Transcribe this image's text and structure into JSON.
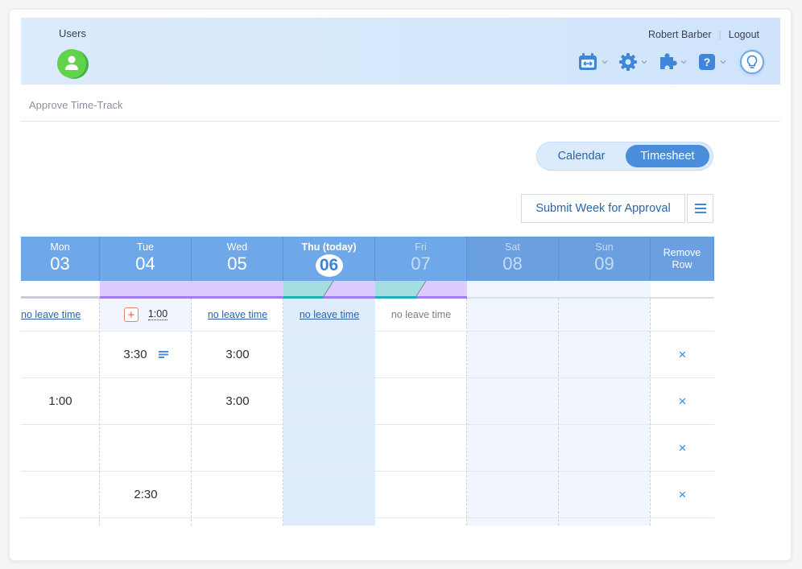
{
  "header": {
    "section_label": "Users",
    "avatar_icon": "user-avatar-icon",
    "user_name": "Robert Barber",
    "logout_label": "Logout",
    "toolbar": [
      {
        "icon": "calendar-swap-icon",
        "has_dropdown": true
      },
      {
        "icon": "gear-icon",
        "has_dropdown": true
      },
      {
        "icon": "puzzle-icon",
        "has_dropdown": true
      },
      {
        "icon": "help-icon",
        "has_dropdown": true
      },
      {
        "icon": "lightbulb-icon",
        "has_dropdown": false
      }
    ]
  },
  "breadcrumb": "Approve Time-Track",
  "view_toggle": {
    "options": [
      "Calendar",
      "Timesheet"
    ],
    "selected": "Timesheet"
  },
  "actions": {
    "submit_label": "Submit Week for Approval",
    "menu_icon": "hamburger-menu-icon"
  },
  "colors": {
    "header_blue": "#6ea8e8",
    "accent": "#4a8ddb",
    "approved_purple": "#dccbfc",
    "partial_teal": "#a4dee0",
    "delete_x": "#3f85d8",
    "add_leave_red": "#e25b3d"
  },
  "days": [
    {
      "name": "Mon",
      "num": "03",
      "leave": "no leave time",
      "leave_style": "link",
      "status": "none"
    },
    {
      "name": "Tue",
      "num": "04",
      "leave": "1:00",
      "leave_style": "value-with-add",
      "status": "submitted"
    },
    {
      "name": "Wed",
      "num": "05",
      "leave": "no leave time",
      "leave_style": "link",
      "status": "submitted"
    },
    {
      "name": "Thu (today)",
      "num": "06",
      "leave": "no leave time",
      "leave_style": "link",
      "status": "partial",
      "today": true
    },
    {
      "name": "Fri",
      "num": "07",
      "leave": "no leave time",
      "leave_style": "plain",
      "status": "partial",
      "faded": true
    },
    {
      "name": "Sat",
      "num": "08",
      "leave": "",
      "leave_style": "none",
      "status": "none",
      "faded": true,
      "weekend": true
    },
    {
      "name": "Sun",
      "num": "09",
      "leave": "",
      "leave_style": "none",
      "status": "none",
      "faded": true,
      "weekend": true
    }
  ],
  "remove_col_label": "Remove Row",
  "remove_icon": "×",
  "rows": [
    {
      "values": [
        "",
        "3:30",
        "3:00",
        "",
        "",
        "",
        ""
      ],
      "note_on": 1
    },
    {
      "values": [
        "1:00",
        "",
        "3:00",
        "",
        "",
        "",
        ""
      ]
    },
    {
      "values": [
        "",
        "",
        "",
        "",
        "",
        "",
        ""
      ]
    },
    {
      "values": [
        "",
        "2:30",
        "",
        "",
        "",
        "",
        ""
      ]
    }
  ]
}
